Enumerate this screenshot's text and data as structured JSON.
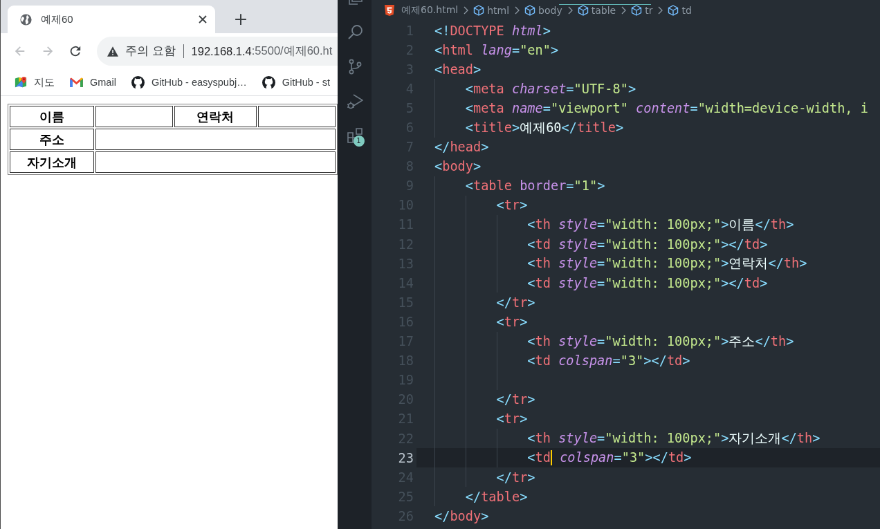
{
  "browser": {
    "tabs": [
      {
        "title": "예제60",
        "selected": true
      }
    ],
    "nav": [
      {
        "kind": "back",
        "disabled": true
      },
      {
        "kind": "forward",
        "disabled": true
      },
      {
        "kind": "reload",
        "disabled": false
      }
    ],
    "address": {
      "warning": "주의 요함",
      "host": "192.168.1.4",
      "path": ":5500/예제60.ht"
    },
    "bookmarks": [
      {
        "kind": "map",
        "label": "지도"
      },
      {
        "kind": "mail",
        "label": "Gmail"
      },
      {
        "kind": "repo",
        "label": "GitHub - easyspubj…"
      },
      {
        "kind": "repo",
        "label": "GitHub - st"
      }
    ],
    "table": {
      "rows": [
        [
          {
            "kind": "header",
            "text": "이름"
          },
          {
            "kind": "data",
            "wide": false
          },
          {
            "kind": "header",
            "text": "연락처"
          },
          {
            "kind": "data",
            "wide": false
          }
        ],
        [
          {
            "kind": "header",
            "text": "주소"
          },
          {
            "kind": "data",
            "wide": true
          }
        ],
        [
          {
            "kind": "header",
            "text": "자기소개"
          },
          {
            "kind": "data",
            "wide": true
          }
        ]
      ]
    }
  },
  "editor": {
    "activity": [
      {
        "kind": "files"
      },
      {
        "kind": "search"
      },
      {
        "kind": "source_control"
      },
      {
        "kind": "run_debug"
      },
      {
        "kind": "extensions",
        "badge": "1"
      }
    ],
    "breadcrumb": [
      {
        "kind": "file",
        "text": "예제60.html"
      },
      {
        "kind": "element",
        "text": "html"
      },
      {
        "kind": "element",
        "text": "body"
      },
      {
        "kind": "element",
        "text": "table"
      },
      {
        "kind": "element",
        "text": "tr"
      },
      {
        "kind": "element",
        "text": "td"
      }
    ],
    "lines": [
      {
        "number": "1",
        "current": false,
        "tokens": [
          {
            "kind": "punct",
            "text": "<!"
          },
          {
            "kind": "tag",
            "text": "DOCTYPE"
          },
          {
            "kind": "attr",
            "text": " html"
          },
          {
            "kind": "punct",
            "text": ">"
          }
        ]
      },
      {
        "number": "2",
        "current": false,
        "tokens": [
          {
            "kind": "punct",
            "text": "<"
          },
          {
            "kind": "tag",
            "text": "html"
          },
          {
            "kind": "attr",
            "text": " lang"
          },
          {
            "kind": "punct",
            "text": "="
          },
          {
            "kind": "string",
            "text": "\"en\""
          },
          {
            "kind": "punct",
            "text": ">"
          }
        ]
      },
      {
        "number": "3",
        "current": false,
        "tokens": [
          {
            "kind": "punct",
            "text": "<"
          },
          {
            "kind": "tag",
            "text": "head"
          },
          {
            "kind": "punct",
            "text": ">"
          }
        ]
      },
      {
        "number": "4",
        "current": false,
        "tokens": [
          {
            "kind": "punct",
            "text": "    <"
          },
          {
            "kind": "tag",
            "text": "meta"
          },
          {
            "kind": "attr",
            "text": " charset"
          },
          {
            "kind": "punct",
            "text": "="
          },
          {
            "kind": "string",
            "text": "\"UTF-8\""
          },
          {
            "kind": "punct",
            "text": ">"
          }
        ]
      },
      {
        "number": "5",
        "current": false,
        "tokens": [
          {
            "kind": "punct",
            "text": "    <"
          },
          {
            "kind": "tag",
            "text": "meta"
          },
          {
            "kind": "attr",
            "text": " name"
          },
          {
            "kind": "punct",
            "text": "="
          },
          {
            "kind": "string",
            "text": "\"viewport\""
          },
          {
            "kind": "attr",
            "text": " content"
          },
          {
            "kind": "punct",
            "text": "="
          },
          {
            "kind": "string",
            "text": "\"width=device-width, i"
          }
        ]
      },
      {
        "number": "6",
        "current": false,
        "tokens": [
          {
            "kind": "punct",
            "text": "    <"
          },
          {
            "kind": "tag",
            "text": "title"
          },
          {
            "kind": "punct",
            "text": ">"
          },
          {
            "kind": "text",
            "text": "예제60"
          },
          {
            "kind": "punct",
            "text": "</"
          },
          {
            "kind": "tag",
            "text": "title"
          },
          {
            "kind": "punct",
            "text": ">"
          }
        ]
      },
      {
        "number": "7",
        "current": false,
        "tokens": [
          {
            "kind": "punct",
            "text": "</"
          },
          {
            "kind": "tag",
            "text": "head"
          },
          {
            "kind": "punct",
            "text": ">"
          }
        ]
      },
      {
        "number": "8",
        "current": false,
        "tokens": [
          {
            "kind": "punct",
            "text": "<"
          },
          {
            "kind": "tag",
            "text": "body"
          },
          {
            "kind": "punct",
            "text": ">"
          }
        ]
      },
      {
        "number": "9",
        "current": false,
        "tokens": [
          {
            "kind": "punct",
            "text": "    <"
          },
          {
            "kind": "tag",
            "text": "table"
          },
          {
            "kind": "attr_plain",
            "text": " border"
          },
          {
            "kind": "punct",
            "text": "="
          },
          {
            "kind": "string",
            "text": "\"1\""
          },
          {
            "kind": "punct",
            "text": ">"
          }
        ]
      },
      {
        "number": "10",
        "current": false,
        "tokens": [
          {
            "kind": "punct",
            "text": "        <"
          },
          {
            "kind": "tag",
            "text": "tr"
          },
          {
            "kind": "punct",
            "text": ">"
          }
        ]
      },
      {
        "number": "11",
        "current": false,
        "tokens": [
          {
            "kind": "punct",
            "text": "            <"
          },
          {
            "kind": "tag",
            "text": "th"
          },
          {
            "kind": "attr",
            "text": " style"
          },
          {
            "kind": "punct",
            "text": "="
          },
          {
            "kind": "string",
            "text": "\"width: 100px;\""
          },
          {
            "kind": "punct",
            "text": ">"
          },
          {
            "kind": "text",
            "text": "이름"
          },
          {
            "kind": "punct",
            "text": "</"
          },
          {
            "kind": "tag",
            "text": "th"
          },
          {
            "kind": "punct",
            "text": ">"
          }
        ]
      },
      {
        "number": "12",
        "current": false,
        "tokens": [
          {
            "kind": "punct",
            "text": "            <"
          },
          {
            "kind": "tag",
            "text": "td"
          },
          {
            "kind": "attr",
            "text": " style"
          },
          {
            "kind": "punct",
            "text": "="
          },
          {
            "kind": "string",
            "text": "\"width: 100px;\""
          },
          {
            "kind": "punct",
            "text": "></"
          },
          {
            "kind": "tag",
            "text": "td"
          },
          {
            "kind": "punct",
            "text": ">"
          }
        ]
      },
      {
        "number": "13",
        "current": false,
        "tokens": [
          {
            "kind": "punct",
            "text": "            <"
          },
          {
            "kind": "tag",
            "text": "th"
          },
          {
            "kind": "attr",
            "text": " style"
          },
          {
            "kind": "punct",
            "text": "="
          },
          {
            "kind": "string",
            "text": "\"width: 100px;\""
          },
          {
            "kind": "punct",
            "text": ">"
          },
          {
            "kind": "text",
            "text": "연락처"
          },
          {
            "kind": "punct",
            "text": "</"
          },
          {
            "kind": "tag",
            "text": "th"
          },
          {
            "kind": "punct",
            "text": ">"
          }
        ]
      },
      {
        "number": "14",
        "current": false,
        "tokens": [
          {
            "kind": "punct",
            "text": "            <"
          },
          {
            "kind": "tag",
            "text": "td"
          },
          {
            "kind": "attr",
            "text": " style"
          },
          {
            "kind": "punct",
            "text": "="
          },
          {
            "kind": "string",
            "text": "\"width: 100px;\""
          },
          {
            "kind": "punct",
            "text": "></"
          },
          {
            "kind": "tag",
            "text": "td"
          },
          {
            "kind": "punct",
            "text": ">"
          }
        ]
      },
      {
        "number": "15",
        "current": false,
        "tokens": [
          {
            "kind": "punct",
            "text": "        </"
          },
          {
            "kind": "tag",
            "text": "tr"
          },
          {
            "kind": "punct",
            "text": ">"
          }
        ]
      },
      {
        "number": "16",
        "current": false,
        "tokens": [
          {
            "kind": "punct",
            "text": "        <"
          },
          {
            "kind": "tag",
            "text": "tr"
          },
          {
            "kind": "punct",
            "text": ">"
          }
        ]
      },
      {
        "number": "17",
        "current": false,
        "tokens": [
          {
            "kind": "punct",
            "text": "            <"
          },
          {
            "kind": "tag",
            "text": "th"
          },
          {
            "kind": "attr",
            "text": " style"
          },
          {
            "kind": "punct",
            "text": "="
          },
          {
            "kind": "string",
            "text": "\"width: 100px;\""
          },
          {
            "kind": "punct",
            "text": ">"
          },
          {
            "kind": "text",
            "text": "주소"
          },
          {
            "kind": "punct",
            "text": "</"
          },
          {
            "kind": "tag",
            "text": "th"
          },
          {
            "kind": "punct",
            "text": ">"
          }
        ]
      },
      {
        "number": "18",
        "current": false,
        "tokens": [
          {
            "kind": "punct",
            "text": "            <"
          },
          {
            "kind": "tag",
            "text": "td"
          },
          {
            "kind": "attr",
            "text": " colspan"
          },
          {
            "kind": "punct",
            "text": "="
          },
          {
            "kind": "string",
            "text": "\"3\""
          },
          {
            "kind": "punct",
            "text": "></"
          },
          {
            "kind": "tag",
            "text": "td"
          },
          {
            "kind": "punct",
            "text": ">"
          }
        ]
      },
      {
        "number": "19",
        "current": false
      },
      {
        "number": "20",
        "current": false,
        "tokens": [
          {
            "kind": "punct",
            "text": "        </"
          },
          {
            "kind": "tag",
            "text": "tr"
          },
          {
            "kind": "punct",
            "text": ">"
          }
        ]
      },
      {
        "number": "21",
        "current": false,
        "tokens": [
          {
            "kind": "punct",
            "text": "        <"
          },
          {
            "kind": "tag",
            "text": "tr"
          },
          {
            "kind": "punct",
            "text": ">"
          }
        ]
      },
      {
        "number": "22",
        "current": false,
        "tokens": [
          {
            "kind": "punct",
            "text": "            <"
          },
          {
            "kind": "tag",
            "text": "th"
          },
          {
            "kind": "attr",
            "text": " style"
          },
          {
            "kind": "punct",
            "text": "="
          },
          {
            "kind": "string",
            "text": "\"width: 100px;\""
          },
          {
            "kind": "punct",
            "text": ">"
          },
          {
            "kind": "text",
            "text": "자기소개"
          },
          {
            "kind": "punct",
            "text": "</"
          },
          {
            "kind": "tag",
            "text": "th"
          },
          {
            "kind": "punct",
            "text": ">"
          }
        ]
      },
      {
        "number": "23",
        "current": true,
        "tokens": [
          {
            "kind": "punct",
            "text": "            <"
          },
          {
            "kind": "tag",
            "text": "td",
            "caret": true
          },
          {
            "kind": "attr",
            "text": " colspan"
          },
          {
            "kind": "punct",
            "text": "="
          },
          {
            "kind": "string",
            "text": "\"3\""
          },
          {
            "kind": "punct",
            "text": "></"
          },
          {
            "kind": "tag",
            "text": "td"
          },
          {
            "kind": "punct",
            "text": ">"
          }
        ]
      },
      {
        "number": "24",
        "current": false,
        "tokens": [
          {
            "kind": "punct",
            "text": "        </"
          },
          {
            "kind": "tag",
            "text": "tr"
          },
          {
            "kind": "punct",
            "text": ">"
          }
        ]
      },
      {
        "number": "25",
        "current": false,
        "tokens": [
          {
            "kind": "punct",
            "text": "    </"
          },
          {
            "kind": "tag",
            "text": "table"
          },
          {
            "kind": "punct",
            "text": ">"
          }
        ]
      },
      {
        "number": "26",
        "current": false,
        "tokens": [
          {
            "kind": "punct",
            "text": "</"
          },
          {
            "kind": "tag",
            "text": "body"
          },
          {
            "kind": "punct",
            "text": ">"
          }
        ]
      }
    ]
  }
}
